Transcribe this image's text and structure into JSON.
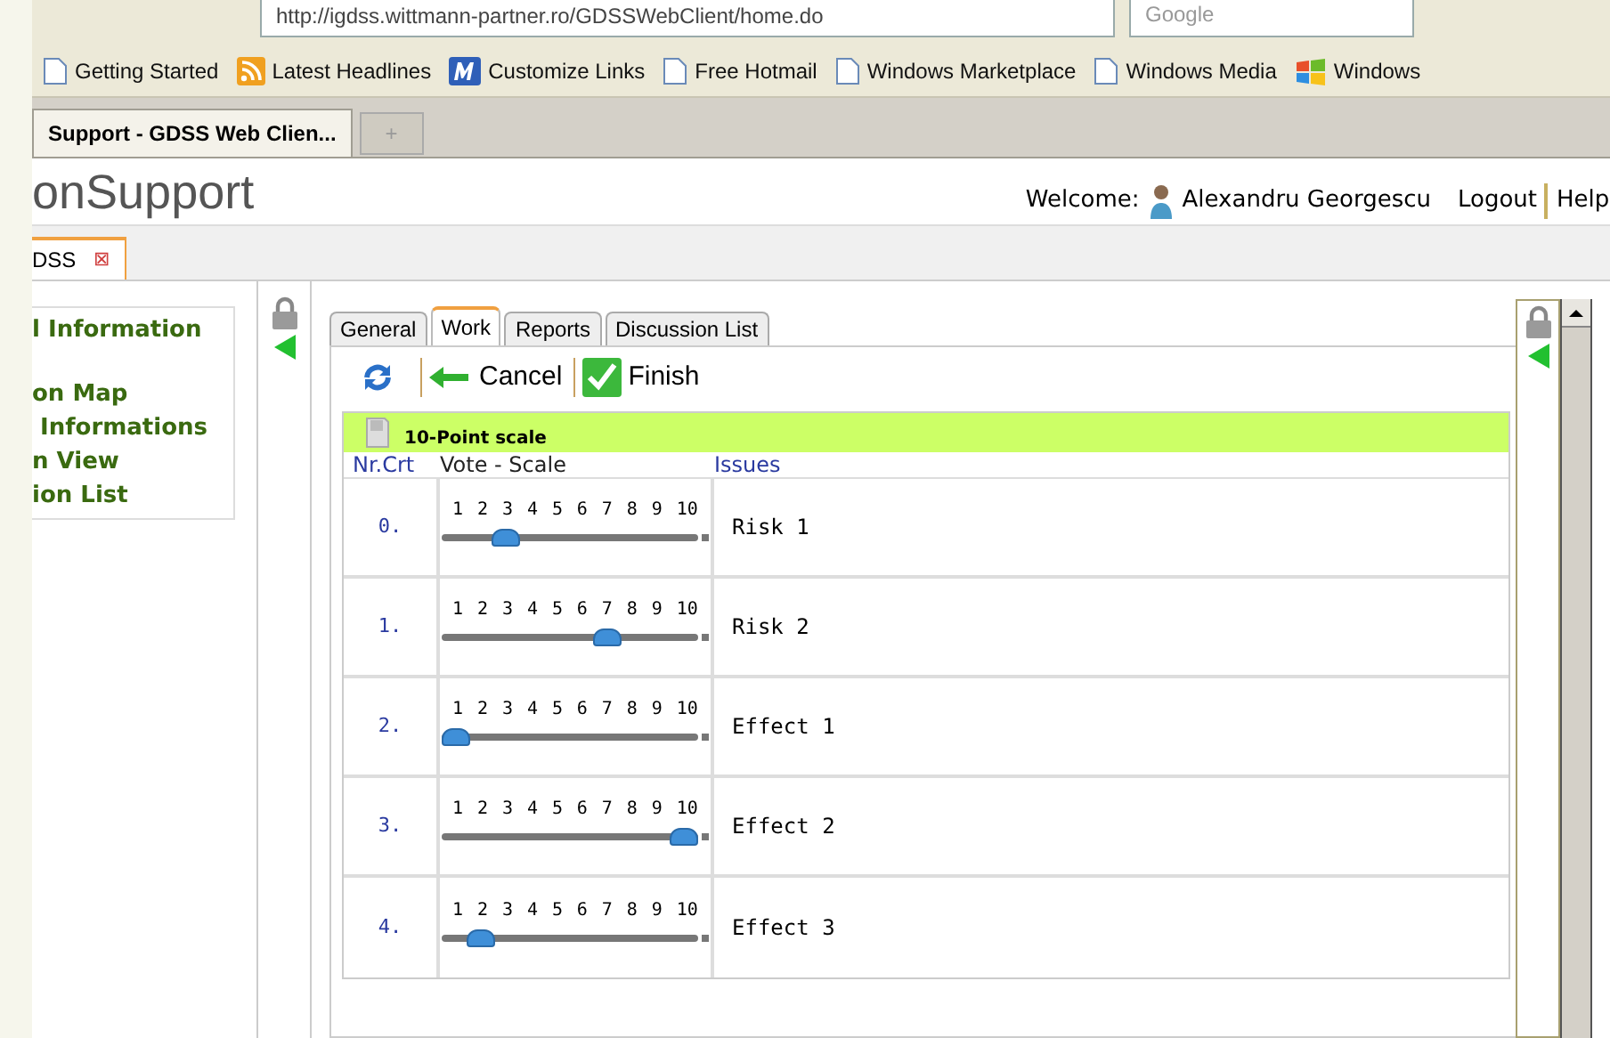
{
  "browser": {
    "url": "http://igdss.wittmann-partner.ro/GDSSWebClient/home.do",
    "search_placeholder": "Google",
    "bookmarks": [
      {
        "label": "Getting Started",
        "kind": "page"
      },
      {
        "label": "Latest Headlines",
        "kind": "feed"
      },
      {
        "label": "Customize Links",
        "kind": "m"
      },
      {
        "label": "Free Hotmail",
        "kind": "page"
      },
      {
        "label": "Windows Marketplace",
        "kind": "page"
      },
      {
        "label": "Windows Media",
        "kind": "page"
      },
      {
        "label": "Windows",
        "kind": "windows"
      }
    ],
    "tabs": [
      {
        "label": "Support - GDSS Web Clien...",
        "selected": true
      }
    ],
    "new_tab": "+"
  },
  "app": {
    "title": "onSupport",
    "welcome": "Welcome:",
    "user": "Alexandru Georgescu",
    "logout": "Logout",
    "help": "Help",
    "doc_tab": {
      "label": "DSS",
      "close": "⊠"
    },
    "sidebar": [
      {
        "label": "l Information"
      },
      {
        "label": "on Map"
      },
      {
        "label": " Informations"
      },
      {
        "label": "n View"
      },
      {
        "label": "ion List"
      }
    ],
    "tabs": [
      {
        "label": "General",
        "selected": false
      },
      {
        "label": "Work",
        "selected": true
      },
      {
        "label": "Reports",
        "selected": false
      },
      {
        "label": "Discussion List",
        "selected": false
      }
    ],
    "toolbar": {
      "cancel": "Cancel",
      "finish": "Finish"
    },
    "table": {
      "title": "10-Point scale",
      "columns": [
        "Nr.Crt",
        "Vote - Scale",
        "Issues"
      ],
      "rows": [
        {
          "nr": "0.",
          "scale": [
            "1",
            "2",
            "3",
            "4",
            "5",
            "6",
            "7",
            "8",
            "9",
            "10"
          ],
          "level": 0.222,
          "issue": "Risk 1"
        },
        {
          "nr": "1.",
          "scale": [
            "1",
            "2",
            "3",
            "4",
            "5",
            "6",
            "7",
            "8",
            "9",
            "10"
          ],
          "level": 0.667,
          "issue": "Risk 2"
        },
        {
          "nr": "2.",
          "scale": [
            "1",
            "2",
            "3",
            "4",
            "5",
            "6",
            "7",
            "8",
            "9",
            "10"
          ],
          "level": 0,
          "issue": "Effect 1"
        },
        {
          "nr": "3.",
          "scale": [
            "1",
            "2",
            "3",
            "4",
            "5",
            "6",
            "7",
            "8",
            "9",
            "10"
          ],
          "level": 1,
          "issue": "Effect 2"
        },
        {
          "nr": "4.",
          "scale": [
            "1",
            "2",
            "3",
            "4",
            "5",
            "6",
            "7",
            "8",
            "9",
            "10"
          ],
          "level": 0.111,
          "issue": "Effect 3"
        }
      ]
    }
  }
}
